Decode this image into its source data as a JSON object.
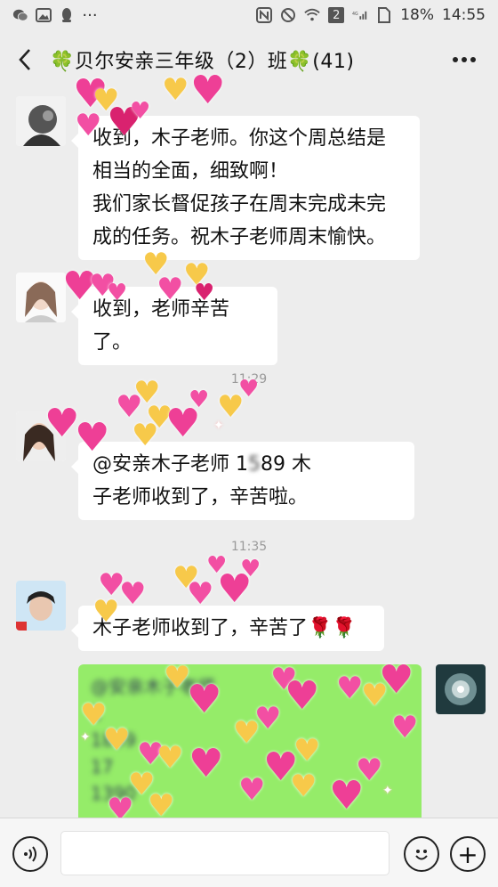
{
  "status_bar": {
    "left_icons": [
      "wechat-icon",
      "image-icon",
      "qq-icon",
      "more-notifications-icon"
    ],
    "right_icons": [
      "nfc-icon",
      "mute-icon",
      "wifi-icon",
      "sim2-icon",
      "signal-4g-icon",
      "sim-icon"
    ],
    "network_label": "2",
    "battery_percent": "18%",
    "time": "14:55"
  },
  "header": {
    "title": "🍀贝尔安亲三年级（2）班🍀(41)",
    "back_icon": "chevron-left-icon",
    "more_icon": "more-dots-icon"
  },
  "messages": [
    {
      "text_lines": [
        "收到，木子老师。你这个周总结是",
        "相当的全面，细致啊！",
        "我们家长督促孩子在周末完成未完",
        "成的任务。祝木子老师周末愉快。"
      ]
    },
    {
      "text_lines": [
        "收到，老师辛苦了。"
      ]
    },
    {
      "timestamp": "11:29",
      "text_line1_prefix": "@安亲木子老师 1",
      "text_line1_masked": "5",
      "text_line1_suffix": "89 木",
      "text_line2": "子老师收到了，辛苦啦。"
    },
    {
      "timestamp": "11:35",
      "text": "木子老师收到了，辛苦了🌹🌹"
    },
    {
      "blurred_lines": [
        "@安亲木子老师",
        "1",
        "1899",
        "17",
        "1390"
      ]
    }
  ],
  "input_bar": {
    "voice_icon": "voice-icon",
    "emoji_icon": "emoji-icon",
    "plus_icon": "plus-icon",
    "plus_glyph": "+"
  },
  "colors": {
    "background": "#ededed",
    "bubble_white": "#ffffff",
    "bubble_green": "#95ec69",
    "heart_pink": "#f24fa3"
  }
}
